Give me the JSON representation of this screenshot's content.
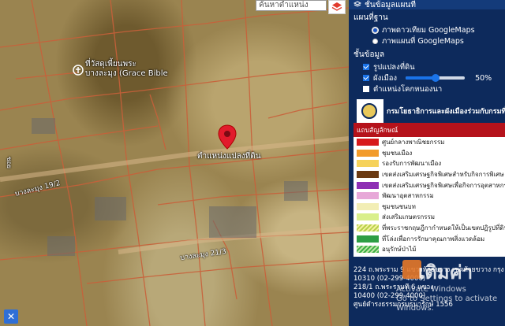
{
  "map": {
    "search_placeholder": "ค้นหาตำแหน่ง",
    "poi_label_line1": "ที่วัสดุเพี้ยนพระ",
    "poi_label_line2": "บางละมุง (Grace Bible",
    "pin_label": "ตำแหน่งแปลงที่ดิน",
    "road_label_1": "บางละมุง 19/2",
    "road_label_2": "บางละมุง 21/3",
    "road_prefix": "ซอย",
    "close_glyph": "✕"
  },
  "panel": {
    "header": "ชั้นข้อมูลแผนที่",
    "basemap_title": "แผนที่ฐาน",
    "basemap_options": [
      {
        "label": "ภาพดาวเทียม GoogleMaps",
        "selected": true
      },
      {
        "label": "ภาพแผนที่ GoogleMaps",
        "selected": false
      }
    ],
    "layers_title": "ชั้นข้อมูล",
    "layers": [
      {
        "label": "รูปแปลงที่ดิน",
        "checked": true
      },
      {
        "label": "ผังเมือง",
        "checked": true,
        "opacity_label": "50%",
        "opacity": 0.5
      },
      {
        "label": "ตำแหน่งโคกหนองนา",
        "checked": false
      }
    ],
    "dept_title": "กรมโยธาธิการและผังเมืองร่วมกับกรมที่ดิน",
    "legend_title": "แถบสัญลักษณ์",
    "legend": [
      {
        "label": "ศูนย์กลางพาณิชยกรรม",
        "color": "#d7191c",
        "pattern": "solid"
      },
      {
        "label": "ชุมชนเมือง",
        "color": "#f29b2a",
        "pattern": "solid"
      },
      {
        "label": "รองรับการพัฒนาเมือง",
        "color": "#f6d25b",
        "pattern": "solid"
      },
      {
        "label": "เขตส่งเสริมเศรษฐกิจพิเศษสำหรับกิจการพิเศษ",
        "color": "#6b3a12",
        "pattern": "solid"
      },
      {
        "label": "เขตส่งเสริมเศรษฐกิจพิเศษเพื่อกิจการอุตสาหกรรม",
        "color": "#8e2fb4",
        "pattern": "solid"
      },
      {
        "label": "พัฒนาอุตสาหกรรม",
        "color": "#e7a8d8",
        "pattern": "solid"
      },
      {
        "label": "ชุมชนชนบท",
        "color": "#f2eeb5",
        "pattern": "solid"
      },
      {
        "label": "ส่งเสริมเกษตรกรรม",
        "color": "#d9ef8b",
        "pattern": "solid"
      },
      {
        "label": "ที่พระราชกฤษฎีกากำหนดให้เป็นเขตปฏิรูปที่ดิน",
        "color": "#b7d14a",
        "pattern": "hatch-yellow"
      },
      {
        "label": "ที่โล่งเพื่อการรักษาคุณภาพสิ่งแวดล้อม",
        "color": "#2e9e44",
        "pattern": "solid"
      },
      {
        "label": "อนุรักษ์ป่าไม้",
        "color": "#3cb043",
        "pattern": "hatch-green"
      }
    ],
    "footer_line1": "224 ถ.พระราม 9 แขวงห้วยขวาง เขตห้วยขวาง กรุง",
    "footer_line2": "10310 (02-299-4000)",
    "footer_line3": "218/1 ถ.พระรามที่ 6 แขวง",
    "footer_line4": "10400 (02-299-4000)",
    "footer_line5": "ศูนย์ดำรงธรรมกรมธนารักษ์ 1556",
    "activate_line1": "Activate Windows",
    "activate_line2": "Go to Settings to activate Windows.",
    "watermark": "เติมค่า"
  }
}
